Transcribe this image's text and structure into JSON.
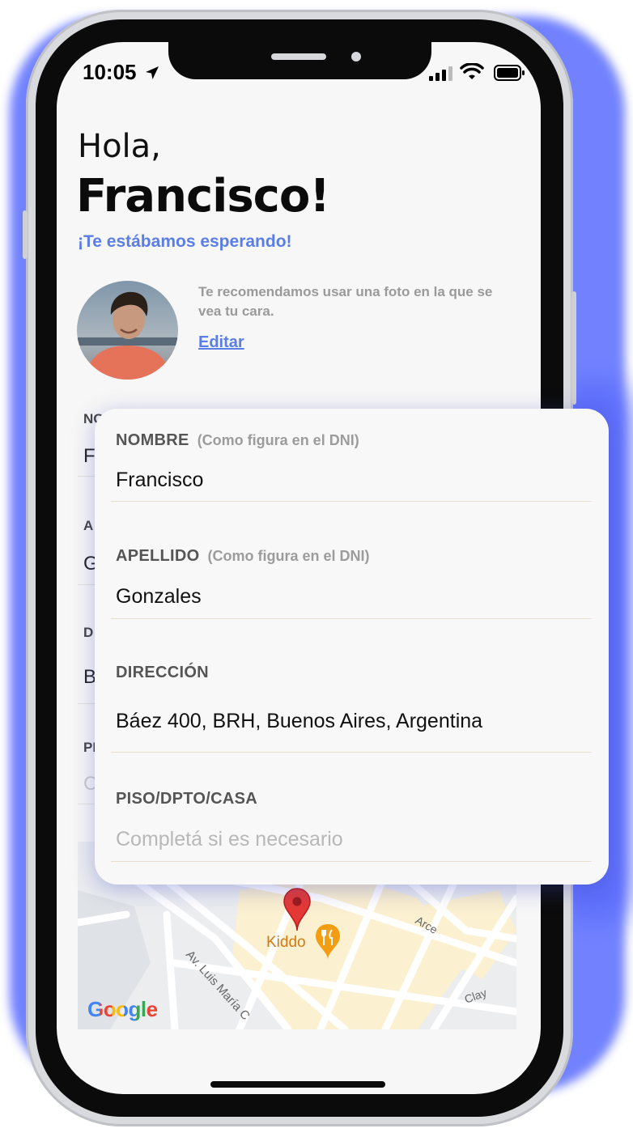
{
  "status_bar": {
    "time": "10:05"
  },
  "greeting": {
    "hello": "Hola,",
    "name": "Francisco!",
    "subtitle": "¡Te estábamos esperando!"
  },
  "profile": {
    "photo_hint": "Te recomendamos usar una foto en la que se vea tu cara.",
    "edit_label": "Editar"
  },
  "background_form": {
    "labels": [
      "NO",
      "A",
      "D",
      "PI"
    ],
    "values": [
      "F",
      "G",
      "B",
      "C"
    ]
  },
  "form": {
    "fields": [
      {
        "label": "NOMBRE",
        "hint": "(Como figura en el DNI)",
        "value": "Francisco",
        "placeholder": ""
      },
      {
        "label": "APELLIDO",
        "hint": "(Como figura en el DNI)",
        "value": "Gonzales",
        "placeholder": ""
      },
      {
        "label": "DIRECCIÓN",
        "hint": "",
        "value": "Báez 400, BRH, Buenos Aires, Argentina",
        "placeholder": ""
      },
      {
        "label": "PISO/DPTO/CASA",
        "hint": "",
        "value": "",
        "placeholder": "Completá si es necesario"
      }
    ]
  },
  "map": {
    "poi": "Kiddo",
    "street_1": "Av. Luis María C",
    "street_2": "Arce",
    "street_3": "Clay",
    "logo": "Google"
  },
  "colors": {
    "accent": "#5a7de8",
    "glow": "#6b7cff",
    "pin": "#e53935",
    "poi": "#f29d13"
  }
}
